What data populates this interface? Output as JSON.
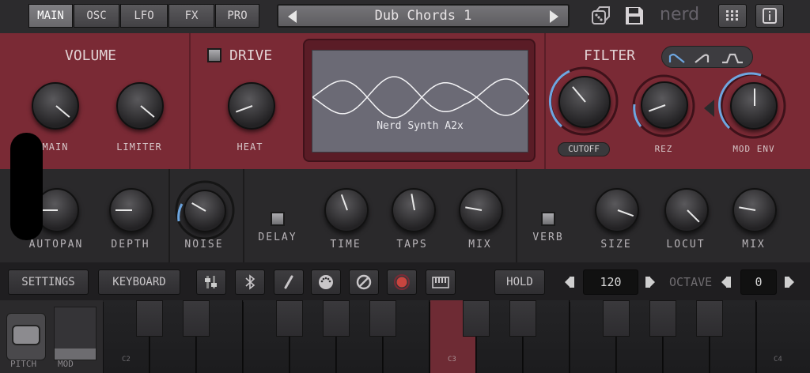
{
  "top_tabs": [
    {
      "label": "MAIN",
      "active": true
    },
    {
      "label": "OSC",
      "active": false
    },
    {
      "label": "LFO",
      "active": false
    },
    {
      "label": "FX",
      "active": false
    },
    {
      "label": "PRO",
      "active": false
    }
  ],
  "preset": {
    "name": "Dub Chords 1"
  },
  "brand": "nerd",
  "volume": {
    "title": "VOLUME",
    "knobs": [
      {
        "label": "MAIN"
      },
      {
        "label": "LIMITER"
      }
    ]
  },
  "drive": {
    "title": "DRIVE",
    "knob": {
      "label": "HEAT"
    }
  },
  "screen": {
    "label": "Nerd Synth A2x"
  },
  "filter": {
    "title": "FILTER",
    "cutoff_label": "CUTOFF",
    "rez_label": "REZ",
    "mod_env_label": "MOD ENV"
  },
  "row2": {
    "autopan": "AUTOPAN",
    "depth": "DEPTH",
    "noise": "NOISE",
    "delay": "DELAY",
    "time": "TIME",
    "taps": "TAPS",
    "mix1": "MIX",
    "verb": "VERB",
    "size": "SIZE",
    "locut": "LOCUT",
    "mix2": "MIX"
  },
  "toolbar": {
    "settings": "SETTINGS",
    "keyboard": "KEYBOARD",
    "hold": "HOLD",
    "tempo": "120",
    "octave_label": "OCTAVE",
    "octave": "0"
  },
  "keys": {
    "c2": "C2",
    "c3": "C3",
    "c4": "C4"
  },
  "pads": {
    "pitch": "PITCH",
    "mod": "MOD"
  },
  "colors": {
    "panel_red": "#7a2a35",
    "accent_blue": "#6ea6e0",
    "highlight_key": "#6e2b34"
  }
}
